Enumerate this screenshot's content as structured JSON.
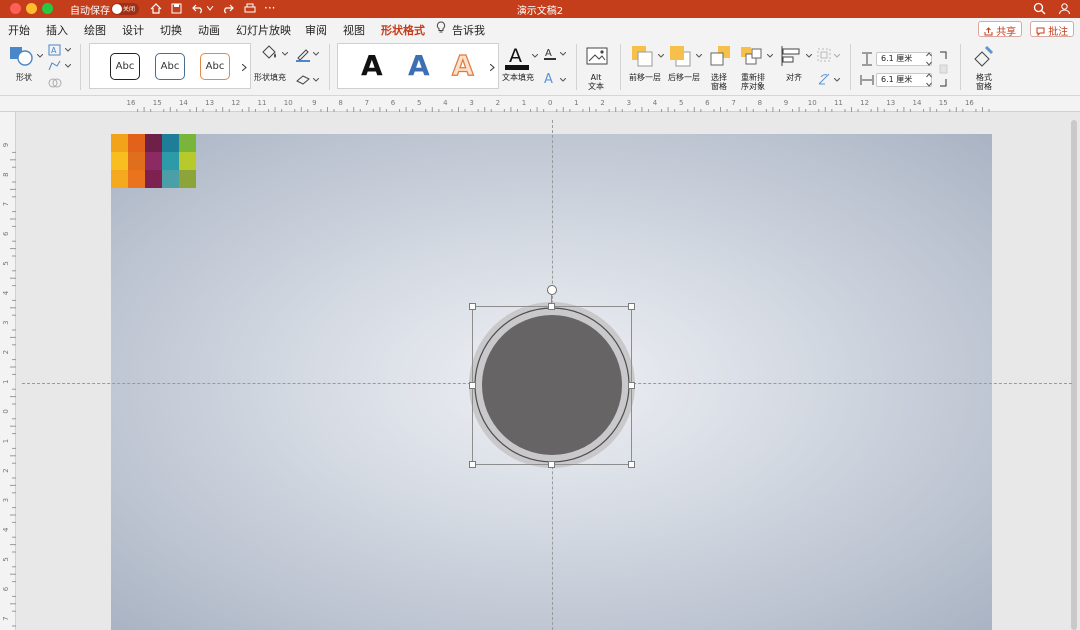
{
  "titlebar": {
    "autosave_label": "自动保存",
    "autosave_state": "关闭",
    "document_title": "演示文稿2",
    "more_label": "···"
  },
  "tabs": [
    "开始",
    "插入",
    "绘图",
    "设计",
    "切换",
    "动画",
    "幻灯片放映",
    "审阅",
    "视图",
    "形状格式",
    "告诉我"
  ],
  "active_tab": "形状格式",
  "share_label": "共享",
  "comment_label": "批注",
  "ribbon": {
    "shape_label": "形状",
    "style_samples": [
      "Abc",
      "Abc",
      "Abc"
    ],
    "shape_fill_label": "形状填充",
    "wordart_samples": [
      "A",
      "A",
      "A"
    ],
    "text_fill_label": "文本填充",
    "alt_text_label": "Alt\n文本",
    "bring_forward_label": "前移一层",
    "send_backward_label": "后移一层",
    "selection_pane_label": "选择\n窗格",
    "reorder_label": "重新排\n序对象",
    "align_label": "对齐",
    "height_value": "6.1 厘米",
    "width_value": "6.1 厘米",
    "format_pane_label": "格式\n窗格"
  },
  "ruler": {
    "top": [
      "16",
      "15",
      "14",
      "13",
      "12",
      "11",
      "10",
      "9",
      "8",
      "7",
      "6",
      "5",
      "4",
      "3",
      "2",
      "1",
      "0",
      "1",
      "2",
      "3",
      "4",
      "5",
      "6",
      "7",
      "8",
      "9",
      "10",
      "11",
      "12",
      "13",
      "14",
      "15",
      "16"
    ],
    "left": [
      "9",
      "8",
      "7",
      "6",
      "5",
      "4",
      "3",
      "2",
      "1",
      "0",
      "1",
      "2",
      "3",
      "4",
      "5",
      "6",
      "7",
      "8"
    ]
  },
  "colors": {
    "accent": "#c43e1c",
    "circle_fill": "#676466",
    "circle_ring": "#c9c8cb",
    "palette": [
      [
        "#f2a31a",
        "#e2621b",
        "#6f2049",
        "#1f7e97",
        "#79b53a"
      ],
      [
        "#f8be1f",
        "#df6f1c",
        "#8e2a63",
        "#2d9aa7",
        "#b7c92b"
      ],
      [
        "#f4a91f",
        "#e9741d",
        "#7d2250",
        "#4aa0a6",
        "#8ca43a"
      ]
    ]
  }
}
